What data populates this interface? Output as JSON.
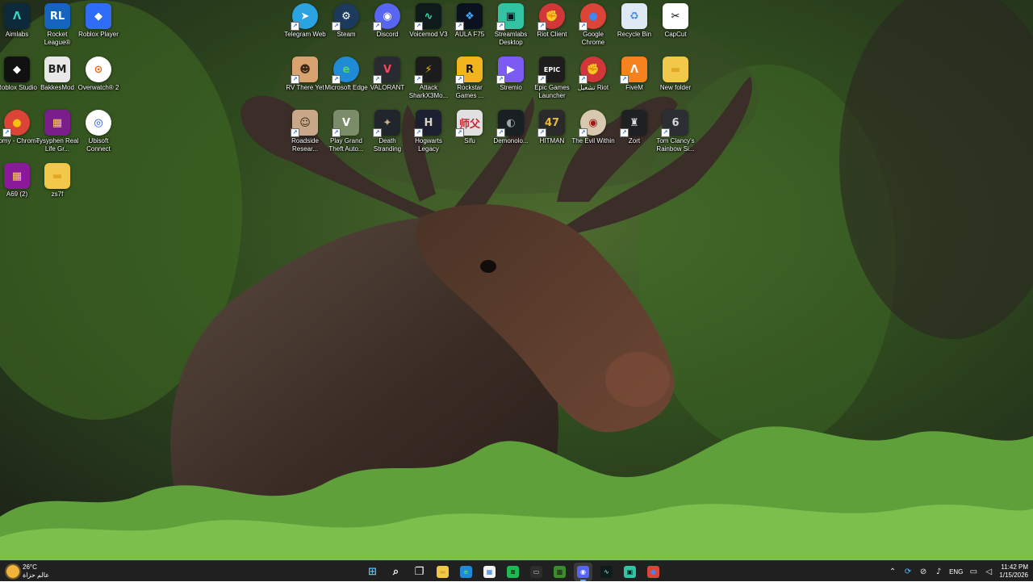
{
  "desktop": {
    "icons": [
      {
        "label": "Aimlabs",
        "glyph": "Λ",
        "bg": "#0d2a3a",
        "fg": "#36d6c3",
        "round": false,
        "shortcut": false
      },
      {
        "label": "Rocket League®",
        "glyph": "RL",
        "bg": "#1565c0",
        "fg": "#ffffff",
        "round": false,
        "shortcut": false
      },
      {
        "label": "Roblox Player",
        "glyph": "◆",
        "bg": "#2f6df6",
        "fg": "#ffffff",
        "round": false,
        "shortcut": false
      },
      {
        "label": "Roblox Studio",
        "glyph": "◆",
        "bg": "#111111",
        "fg": "#ffffff",
        "round": false,
        "shortcut": false
      },
      {
        "label": "BakkesMod",
        "glyph": "BM",
        "bg": "#e8e8e8",
        "fg": "#222222",
        "round": false,
        "shortcut": false
      },
      {
        "label": "Overwatch® 2",
        "glyph": "⊙",
        "bg": "#ffffff",
        "fg": "#f06414",
        "round": true,
        "shortcut": false
      },
      {
        "label": "Somy - Chrome",
        "glyph": "●",
        "bg": "#db4437",
        "fg": "#f4c20d",
        "round": true,
        "shortcut": true
      },
      {
        "label": "Tysyphen Real Life Gr...",
        "glyph": "▦",
        "bg": "#7a1e8c",
        "fg": "#ffd24a",
        "round": false,
        "shortcut": false
      },
      {
        "label": "Ubisoft Connect",
        "glyph": "◎",
        "bg": "#ffffff",
        "fg": "#1b4fd9",
        "round": true,
        "shortcut": false
      },
      {
        "label": "A69 (2)",
        "glyph": "▦",
        "bg": "#8b1a9a",
        "fg": "#ffd24a",
        "round": false,
        "shortcut": false
      },
      {
        "label": "zs7f",
        "glyph": "▬",
        "bg": "#f2c84b",
        "fg": "#e3a823",
        "round": false,
        "shortcut": false
      },
      {
        "label": "Telegram Web",
        "glyph": "➤",
        "bg": "#2aa3e0",
        "fg": "#ffffff",
        "round": true,
        "shortcut": true
      },
      {
        "label": "Steam",
        "glyph": "⚙",
        "bg": "#1b3a5c",
        "fg": "#ffffff",
        "round": true,
        "shortcut": true
      },
      {
        "label": "Discord",
        "glyph": "◉",
        "bg": "#5865f2",
        "fg": "#ffffff",
        "round": true,
        "shortcut": true
      },
      {
        "label": "Voicemod V3",
        "glyph": "∿",
        "bg": "#0f1a1a",
        "fg": "#2de0b0",
        "round": false,
        "shortcut": true
      },
      {
        "label": "AULA F75",
        "glyph": "❖",
        "bg": "#0a1220",
        "fg": "#3fa7ff",
        "round": false,
        "shortcut": true
      },
      {
        "label": "Streamlabs Desktop",
        "glyph": "▣",
        "bg": "#31c3a2",
        "fg": "#09161d",
        "round": false,
        "shortcut": true
      },
      {
        "label": "Riot Client",
        "glyph": "✊",
        "bg": "#d13639",
        "fg": "#ffffff",
        "round": true,
        "shortcut": true
      },
      {
        "label": "Google Chrome",
        "glyph": "●",
        "bg": "#db4437",
        "fg": "#4285f4",
        "round": true,
        "shortcut": true
      },
      {
        "label": "Recycle Bin",
        "glyph": "♻",
        "bg": "#dfe9f3",
        "fg": "#4a8fd8",
        "round": false,
        "shortcut": false
      },
      {
        "label": "CapCut",
        "glyph": "✂",
        "bg": "#ffffff",
        "fg": "#000000",
        "round": false,
        "shortcut": false
      },
      {
        "label": "RV There Yet",
        "glyph": "☻",
        "bg": "#d9a36f",
        "fg": "#3b2514",
        "round": false,
        "shortcut": true
      },
      {
        "label": "Microsoft Edge",
        "glyph": "e",
        "bg": "#1f8ad6",
        "fg": "#52d36b",
        "round": true,
        "shortcut": true
      },
      {
        "label": "VALORANT",
        "glyph": "V",
        "bg": "#2a2a33",
        "fg": "#fd4556",
        "round": false,
        "shortcut": true
      },
      {
        "label": "Attack SharkX3Mo...",
        "glyph": "⚡",
        "bg": "#1c1c1c",
        "fg": "#ffb300",
        "round": false,
        "shortcut": true
      },
      {
        "label": "Rockstar Games ...",
        "glyph": "R",
        "bg": "#f2b41c",
        "fg": "#111111",
        "round": false,
        "shortcut": true
      },
      {
        "label": "Stremio",
        "glyph": "▶",
        "bg": "#7b5bf2",
        "fg": "#ffffff",
        "round": false,
        "shortcut": true
      },
      {
        "label": "Epic Games Launcher",
        "glyph": "EPIC",
        "bg": "#1d1d1d",
        "fg": "#ffffff",
        "round": false,
        "shortcut": true
      },
      {
        "label": "تشغيل Riot",
        "glyph": "✊",
        "bg": "#d13639",
        "fg": "#ffffff",
        "round": true,
        "shortcut": true
      },
      {
        "label": "FiveM",
        "glyph": "Λ",
        "bg": "#f5821f",
        "fg": "#ffffff",
        "round": false,
        "shortcut": true
      },
      {
        "label": "New folder",
        "glyph": "▬",
        "bg": "#f2c84b",
        "fg": "#e3a823",
        "round": false,
        "shortcut": false
      },
      {
        "label": "Roadside Resear...",
        "glyph": "☺",
        "bg": "#c9a889",
        "fg": "#3a2818",
        "round": false,
        "shortcut": true
      },
      {
        "label": "Play Grand Theft Auto...",
        "glyph": "V",
        "bg": "#7a8c6a",
        "fg": "#ffffff",
        "round": false,
        "shortcut": true
      },
      {
        "label": "Death Stranding",
        "glyph": "✦",
        "bg": "#20262c",
        "fg": "#c9b27a",
        "round": false,
        "shortcut": true
      },
      {
        "label": "Hogwarts Legacy",
        "glyph": "H",
        "bg": "#1c2030",
        "fg": "#d9d3c4",
        "round": false,
        "shortcut": true
      },
      {
        "label": "Sifu",
        "glyph": "师父",
        "bg": "#e0e0e0",
        "fg": "#c4262e",
        "round": false,
        "shortcut": true
      },
      {
        "label": "Demonolo...",
        "glyph": "◐",
        "bg": "#1a1f24",
        "fg": "#9aa6ad",
        "round": false,
        "shortcut": true
      },
      {
        "label": "HITMAN",
        "glyph": "47",
        "bg": "#2a2a2a",
        "fg": "#e7b93c",
        "round": false,
        "shortcut": true
      },
      {
        "label": "The Evil Within",
        "glyph": "◉",
        "bg": "#d8c8b0",
        "fg": "#a01818",
        "round": true,
        "shortcut": true
      },
      {
        "label": "Zort",
        "glyph": "♜",
        "bg": "#1f2022",
        "fg": "#dddddd",
        "round": false,
        "shortcut": true
      },
      {
        "label": "Tom Clancy's Rainbow Si...",
        "glyph": "6",
        "bg": "#2b2f33",
        "fg": "#d6d6d6",
        "round": false,
        "shortcut": true
      }
    ]
  },
  "taskbar": {
    "weather": {
      "temp": "26°C",
      "desc": "عالم حزاة"
    },
    "apps": [
      {
        "name": "windows-start-icon",
        "glyph": "⊞",
        "bg": "transparent",
        "fg": "#4cc2ff",
        "active": false
      },
      {
        "name": "search-icon",
        "glyph": "⌕",
        "bg": "transparent",
        "fg": "#ffffff",
        "active": false
      },
      {
        "name": "task-view-icon",
        "glyph": "❐",
        "bg": "transparent",
        "fg": "#ffffff",
        "active": false
      },
      {
        "name": "file-explorer-icon",
        "glyph": "▬",
        "bg": "#f2c84b",
        "fg": "#e3a823",
        "active": false
      },
      {
        "name": "edge-icon",
        "glyph": "e",
        "bg": "#1f8ad6",
        "fg": "#52d36b",
        "active": false
      },
      {
        "name": "store-icon",
        "glyph": "▦",
        "bg": "#f3f3f3",
        "fg": "#2b7de9",
        "active": false
      },
      {
        "name": "spotify-icon",
        "glyph": "≋",
        "bg": "#1db954",
        "fg": "#000000",
        "active": false
      },
      {
        "name": "terminal-icon",
        "glyph": "▭",
        "bg": "#2d2d2d",
        "fg": "#cccccc",
        "active": false
      },
      {
        "name": "minecraft-icon",
        "glyph": "▩",
        "bg": "#3b8d2c",
        "fg": "#1d1d1d",
        "active": false
      },
      {
        "name": "discord-icon",
        "glyph": "◉",
        "bg": "#5865f2",
        "fg": "#ffffff",
        "active": true
      },
      {
        "name": "voicemod-icon",
        "glyph": "∿",
        "bg": "#0f1a1a",
        "fg": "#2de0b0",
        "active": false
      },
      {
        "name": "streamlabs-icon",
        "glyph": "▣",
        "bg": "#31c3a2",
        "fg": "#09161d",
        "active": false
      },
      {
        "name": "chrome-icon",
        "glyph": "●",
        "bg": "#db4437",
        "fg": "#4285f4",
        "active": false
      }
    ],
    "tray": {
      "lang": "ENG",
      "time": "11:42 PM",
      "date": "1/15/2026"
    }
  }
}
